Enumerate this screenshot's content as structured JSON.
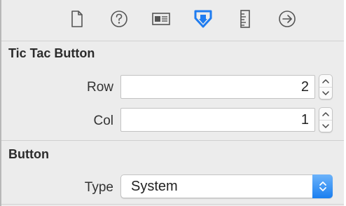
{
  "toolbar": {
    "tabs": [
      {
        "icon": "file-icon",
        "active": false
      },
      {
        "icon": "help-icon",
        "active": false
      },
      {
        "icon": "identity-icon",
        "active": false
      },
      {
        "icon": "attributes-icon",
        "active": true
      },
      {
        "icon": "size-ruler-icon",
        "active": false
      },
      {
        "icon": "connections-arrow-icon",
        "active": false
      }
    ],
    "active_color": "#1f7cf0",
    "icon_color": "#555555"
  },
  "tic_tac_section": {
    "title": "Tic Tac Button",
    "row_label": "Row",
    "row_value": "2",
    "col_label": "Col",
    "col_value": "1"
  },
  "button_section": {
    "title": "Button",
    "type_label": "Type",
    "type_value": "System"
  }
}
